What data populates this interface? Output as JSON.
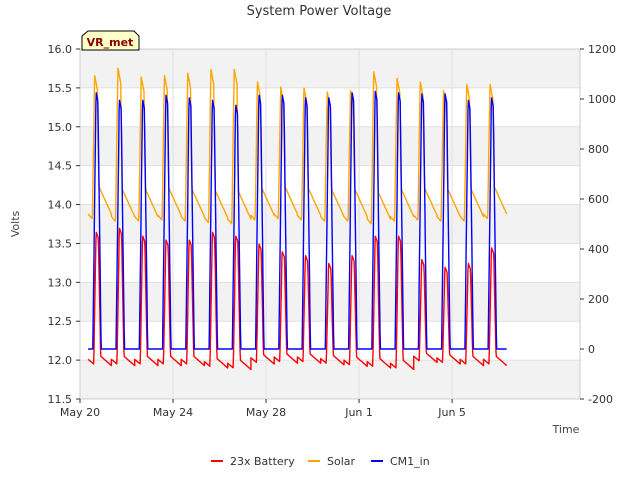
{
  "chart_data": {
    "type": "line",
    "title": "System Power Voltage",
    "xlabel": "Time",
    "ylabel": "Volts",
    "badge": "VR_met",
    "x_range_days": [
      0,
      21.5
    ],
    "x_ticks": [
      {
        "day": 0,
        "label": "May 20"
      },
      {
        "day": 4,
        "label": "May 24"
      },
      {
        "day": 8,
        "label": "May 28"
      },
      {
        "day": 12,
        "label": "Jun 1"
      },
      {
        "day": 16,
        "label": "Jun 5"
      }
    ],
    "ylim": [
      11.5,
      16.0
    ],
    "y_ticks": [
      "11.5",
      "12.0",
      "12.5",
      "13.0",
      "13.5",
      "14.0",
      "14.5",
      "15.0",
      "15.5",
      "16.0"
    ],
    "y2lim": [
      -200,
      1200
    ],
    "y2_ticks": [
      "-200",
      "0",
      "200",
      "400",
      "600",
      "800",
      "1000",
      "1200"
    ],
    "grid": true,
    "legend_position": "bottom",
    "series": [
      {
        "name": "23x Battery",
        "axis": "left",
        "color": "#ff0000",
        "day_peak": [
          13.65,
          13.7,
          13.6,
          13.55,
          13.55,
          13.65,
          13.6,
          13.5,
          13.4,
          13.35,
          13.25,
          13.35,
          13.6,
          13.6,
          13.3,
          13.2,
          13.25,
          13.45
        ],
        "night_min": [
          11.93,
          11.93,
          11.93,
          11.93,
          11.93,
          11.9,
          11.88,
          11.95,
          11.96,
          11.96,
          11.94,
          11.92,
          11.9,
          11.88,
          11.97,
          11.95,
          11.93,
          11.93
        ]
      },
      {
        "name": "Solar",
        "axis": "right",
        "color": "#ffa500",
        "day_peak": [
          1095,
          1125,
          1090,
          1095,
          1105,
          1120,
          1120,
          1070,
          1050,
          1045,
          1030,
          1035,
          1110,
          1085,
          1070,
          1035,
          1060,
          1060
        ],
        "night_min": [
          510,
          500,
          500,
          505,
          500,
          495,
          490,
          505,
          510,
          505,
          500,
          500,
          490,
          500,
          505,
          500,
          500,
          510
        ]
      },
      {
        "name": "CM1_in",
        "axis": "right",
        "color": "#0000ff",
        "day_peak": [
          1030,
          1000,
          1000,
          1020,
          1010,
          1000,
          980,
          1020,
          1020,
          1010,
          1010,
          1030,
          1035,
          1030,
          1025,
          1025,
          1000,
          1010
        ],
        "night_min": [
          0,
          0,
          0,
          0,
          0,
          0,
          0,
          0,
          0,
          0,
          0,
          0,
          0,
          0,
          0,
          0,
          0,
          0
        ]
      }
    ]
  }
}
